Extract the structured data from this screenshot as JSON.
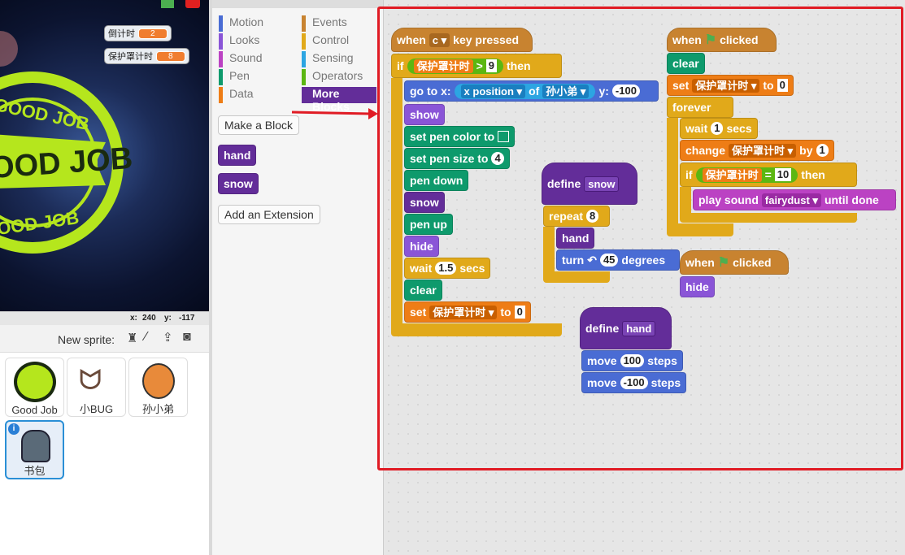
{
  "stage": {
    "monitors": [
      {
        "label": "倒计时",
        "value": "2"
      },
      {
        "label": "保护罩计时",
        "value": "8"
      }
    ],
    "badge_text_top": "GOOD JOB",
    "badge_text_mid": "OOD JOB",
    "badge_text_bottom": "OOD JOB",
    "coords": {
      "x_label": "x:",
      "x": "240",
      "y_label": "y:",
      "y": "-117"
    }
  },
  "sprites": {
    "new_sprite_label": "New sprite:",
    "items": [
      {
        "name": "Good Job",
        "icon": "good-job-badge"
      },
      {
        "name": "小BUG",
        "icon": "bat"
      },
      {
        "name": "孙小弟",
        "icon": "monkey"
      },
      {
        "name": "书包",
        "icon": "backpack",
        "selected": true
      }
    ]
  },
  "palette": {
    "categories_left": [
      {
        "label": "Motion",
        "color": "#4a6cd4"
      },
      {
        "label": "Looks",
        "color": "#8a55d7"
      },
      {
        "label": "Sound",
        "color": "#bb42c3"
      },
      {
        "label": "Pen",
        "color": "#0e9a6c"
      },
      {
        "label": "Data",
        "color": "#ee7d16"
      }
    ],
    "categories_right": [
      {
        "label": "Events",
        "color": "#c88330"
      },
      {
        "label": "Control",
        "color": "#e1a91a"
      },
      {
        "label": "Sensing",
        "color": "#2ca5e2"
      },
      {
        "label": "Operators",
        "color": "#5cb712"
      },
      {
        "label": "More Blocks",
        "color": "#632d99",
        "selected": true
      }
    ],
    "make_block": "Make a Block",
    "custom_blocks": [
      "hand",
      "snow"
    ],
    "add_extension": "Add an Extension"
  },
  "scripts": {
    "s1": {
      "when": "when",
      "key": "c",
      "key_pressed": "key pressed",
      "if": "if",
      "var": "保护罩计时",
      "gt": ">",
      "gt_val": "9",
      "then": "then",
      "goto": "go to x:",
      "xpos": "x position",
      "of": "of",
      "sprite": "孙小弟",
      "y": "y:",
      "y_val": "-100",
      "show": "show",
      "set_pen_color": "set pen color to",
      "set_pen_size": "set pen size to",
      "pen_size": "4",
      "pen_down": "pen down",
      "snow": "snow",
      "pen_up": "pen up",
      "hide": "hide",
      "wait": "wait",
      "wait_val": "1.5",
      "secs": "secs",
      "clear": "clear",
      "set": "set",
      "set_var": "保护罩计时",
      "to": "to",
      "set_val": "0"
    },
    "s2": {
      "define": "define",
      "name": "snow",
      "repeat": "repeat",
      "repeat_val": "8",
      "hand": "hand",
      "turn": "turn",
      "turn_val": "45",
      "degrees": "degrees"
    },
    "s3": {
      "define": "define",
      "name": "hand",
      "move": "move",
      "move1": "100",
      "move2": "-100",
      "steps": "steps"
    },
    "s4": {
      "when": "when",
      "clicked": "clicked",
      "clear": "clear",
      "set": "set",
      "var": "保护罩计时",
      "to": "to",
      "set_val": "0",
      "forever": "forever",
      "wait": "wait",
      "wait_val": "1",
      "secs": "secs",
      "change": "change",
      "by": "by",
      "change_val": "1",
      "if": "if",
      "eq": "=",
      "eq_val": "10",
      "then": "then",
      "play_sound": "play sound",
      "sound": "fairydust",
      "until_done": "until done"
    },
    "s5": {
      "when": "when",
      "clicked": "clicked",
      "hide": "hide"
    }
  }
}
